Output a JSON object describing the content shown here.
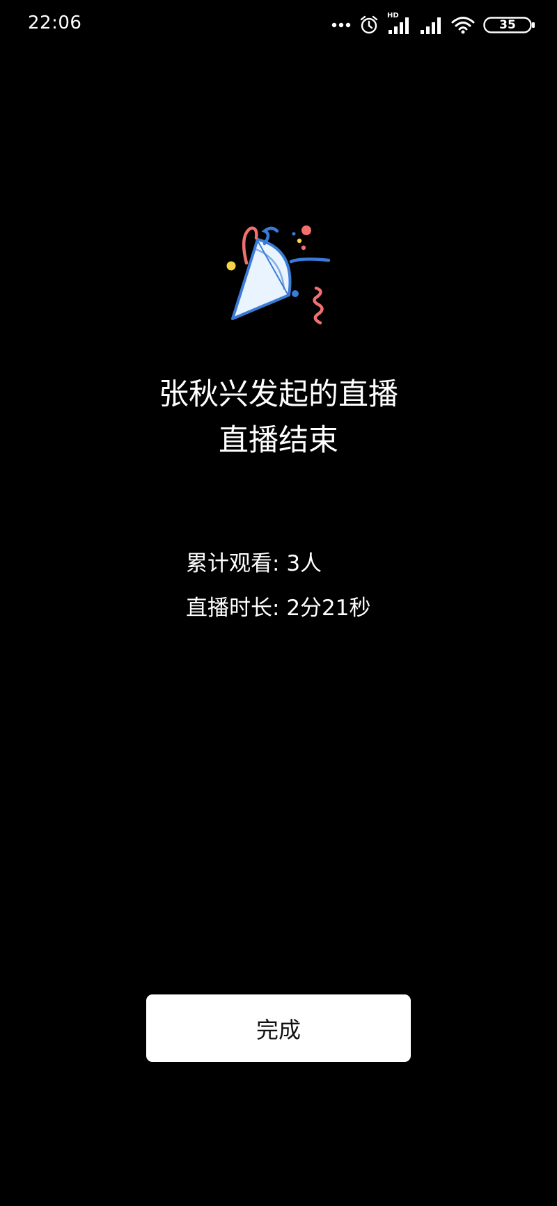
{
  "status_bar": {
    "time": "22:06",
    "network_label": "HD",
    "battery": "35"
  },
  "hero": {
    "icon": "party-popper-icon"
  },
  "live_end": {
    "title_line1": "张秋兴发起的直播",
    "title_line2": "直播结束"
  },
  "stats": {
    "viewers_label": "累计观看: ",
    "viewers_value": "3人",
    "duration_label": "直播时长: ",
    "duration_value": "2分21秒"
  },
  "actions": {
    "done_label": "完成"
  },
  "colors": {
    "background": "#000000",
    "text": "#ffffff",
    "button_bg": "#ffffff",
    "button_text": "#111111",
    "accent_blue": "#3a7bd5",
    "accent_pink": "#f07070",
    "accent_yellow": "#f5d547"
  }
}
